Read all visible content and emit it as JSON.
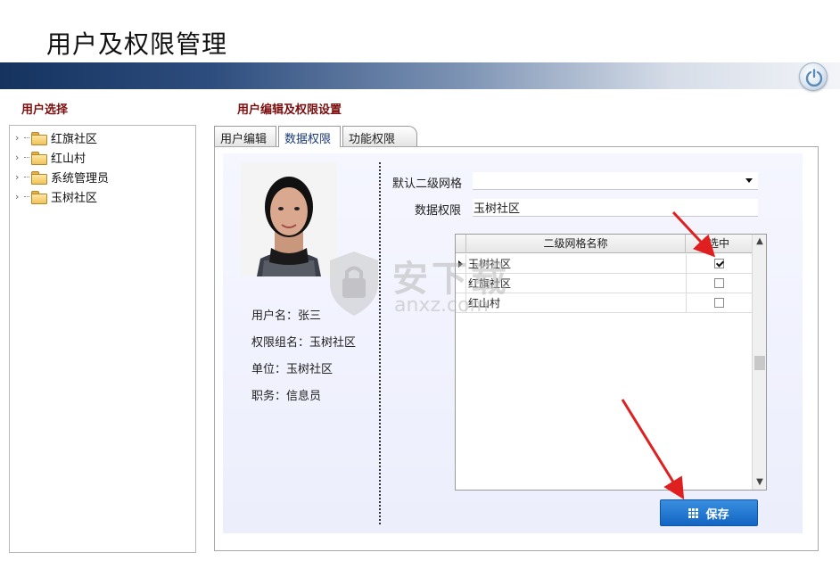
{
  "app": {
    "title": "用户及权限管理"
  },
  "left_panel": {
    "label": "用户选择",
    "tree": [
      {
        "label": "红旗社区"
      },
      {
        "label": "红山村"
      },
      {
        "label": "系统管理员"
      },
      {
        "label": "玉树社区"
      }
    ]
  },
  "right_panel": {
    "label": "用户编辑及权限设置",
    "tabs": [
      {
        "label": "用户编辑"
      },
      {
        "label": "数据权限"
      },
      {
        "label": "功能权限"
      }
    ],
    "active_tab": "数据权限"
  },
  "user_info": {
    "username": "用户名：张三",
    "group": "权限组名：玉树社区",
    "unit": "单位：玉树社区",
    "position": "职务：信息员"
  },
  "form": {
    "default_grid_label": "默认二级网格",
    "default_grid_value": "",
    "data_permission_label": "数据权限",
    "data_permission_value": "玉树社区"
  },
  "grid": {
    "col_name": "二级网格名称",
    "col_selected": "选中",
    "rows": [
      {
        "name": "玉树社区",
        "checked": true
      },
      {
        "name": "红旗社区",
        "checked": false
      },
      {
        "name": "红山村",
        "checked": false
      }
    ]
  },
  "buttons": {
    "save": "保存"
  },
  "watermark": {
    "text": "安下载",
    "sub": "anxz.com"
  },
  "colors": {
    "accent": "#1266c2",
    "header_dark": "#16335f",
    "section_label": "#7a0d0d",
    "annotation_arrow": "#e02020"
  }
}
